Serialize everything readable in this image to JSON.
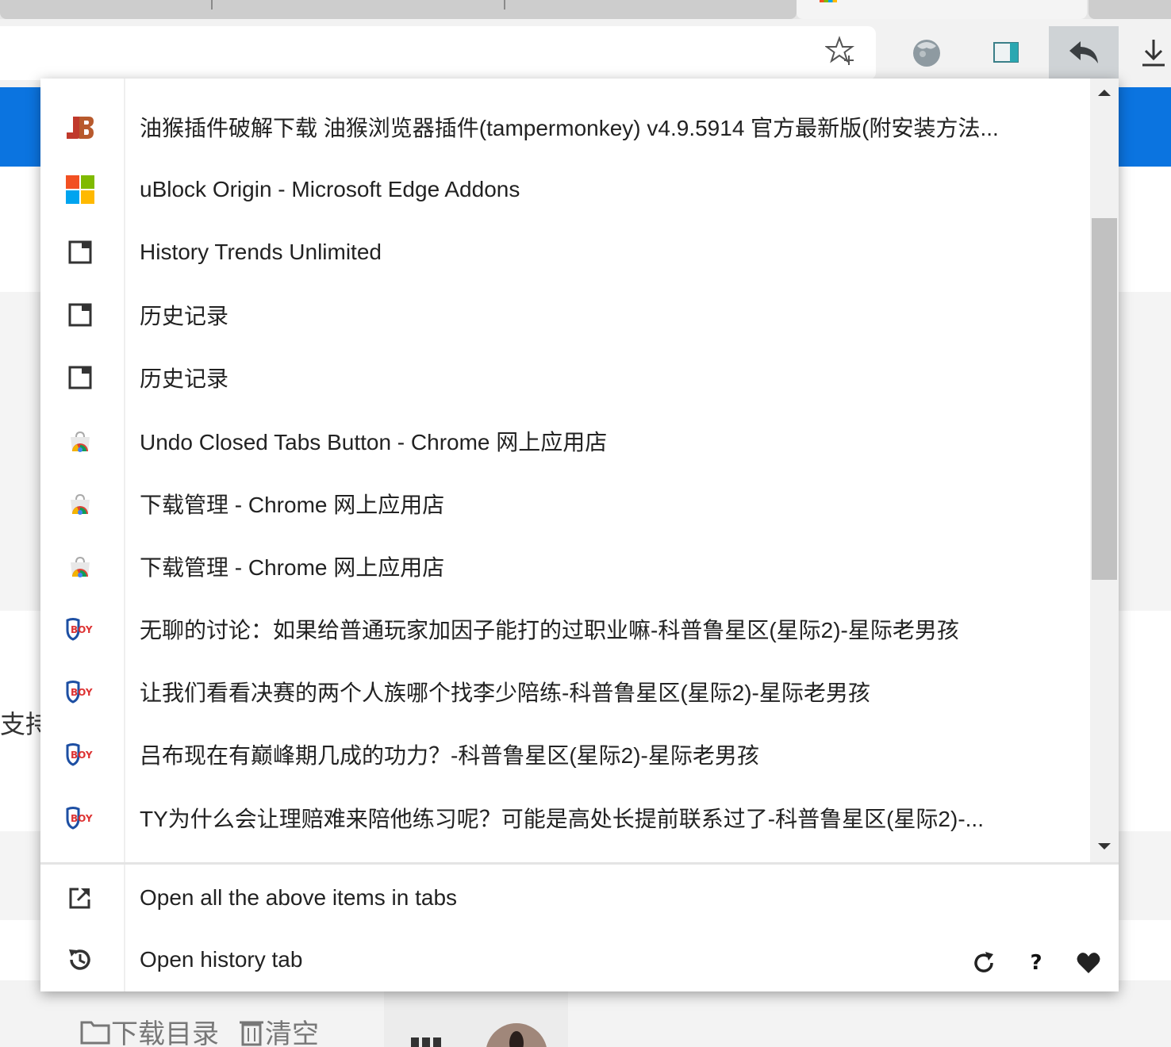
{
  "browser": {
    "toolbar_icons": [
      "star-icon",
      "extension-ball-icon",
      "extension-panel-icon",
      "undo-closed-tabs-icon",
      "download-icon"
    ]
  },
  "page_behind": {
    "side_text": "支持",
    "download_dir_label": "下载目录",
    "clear_label": "清空"
  },
  "popup": {
    "items": [
      {
        "label": "油猴插件破解下载 油猴浏览器插件(tampermonkey) v4.9.5914 官方最新版(附安装方法...",
        "icon": "site-3d-icon"
      },
      {
        "label": "uBlock Origin - Microsoft Edge Addons",
        "icon": "microsoft-logo-icon"
      },
      {
        "label": "History Trends Unlimited",
        "icon": "page-icon"
      },
      {
        "label": "历史记录",
        "icon": "page-icon"
      },
      {
        "label": "历史记录",
        "icon": "page-icon"
      },
      {
        "label": "Undo Closed Tabs Button - Chrome 网上应用店",
        "icon": "chrome-webstore-icon"
      },
      {
        "label": "下载管理 - Chrome 网上应用店",
        "icon": "chrome-webstore-icon"
      },
      {
        "label": "下载管理 - Chrome 网上应用店",
        "icon": "chrome-webstore-icon"
      },
      {
        "label": "无聊的讨论：如果给普通玩家加因子能打的过职业嘛-科普鲁星区(星际2)-星际老男孩",
        "icon": "boy-shield-icon"
      },
      {
        "label": "让我们看看决赛的两个人族哪个找李少陪练-科普鲁星区(星际2)-星际老男孩",
        "icon": "boy-shield-icon"
      },
      {
        "label": "吕布现在有巅峰期几成的功力？-科普鲁星区(星际2)-星际老男孩",
        "icon": "boy-shield-icon"
      },
      {
        "label": "TY为什么会让理赔难来陪他练习呢？可能是高处长提前联系过了-科普鲁星区(星际2)-...",
        "icon": "boy-shield-icon"
      }
    ],
    "footer": {
      "open_all_label": "Open all the above items in tabs",
      "open_history_label": "Open history tab",
      "actions": [
        "refresh-icon",
        "help-icon",
        "heart-icon"
      ],
      "help_glyph": "?"
    }
  },
  "colors": {
    "accent_blue": "#0b74e0",
    "scroll_thumb": "#c1c1c1"
  }
}
